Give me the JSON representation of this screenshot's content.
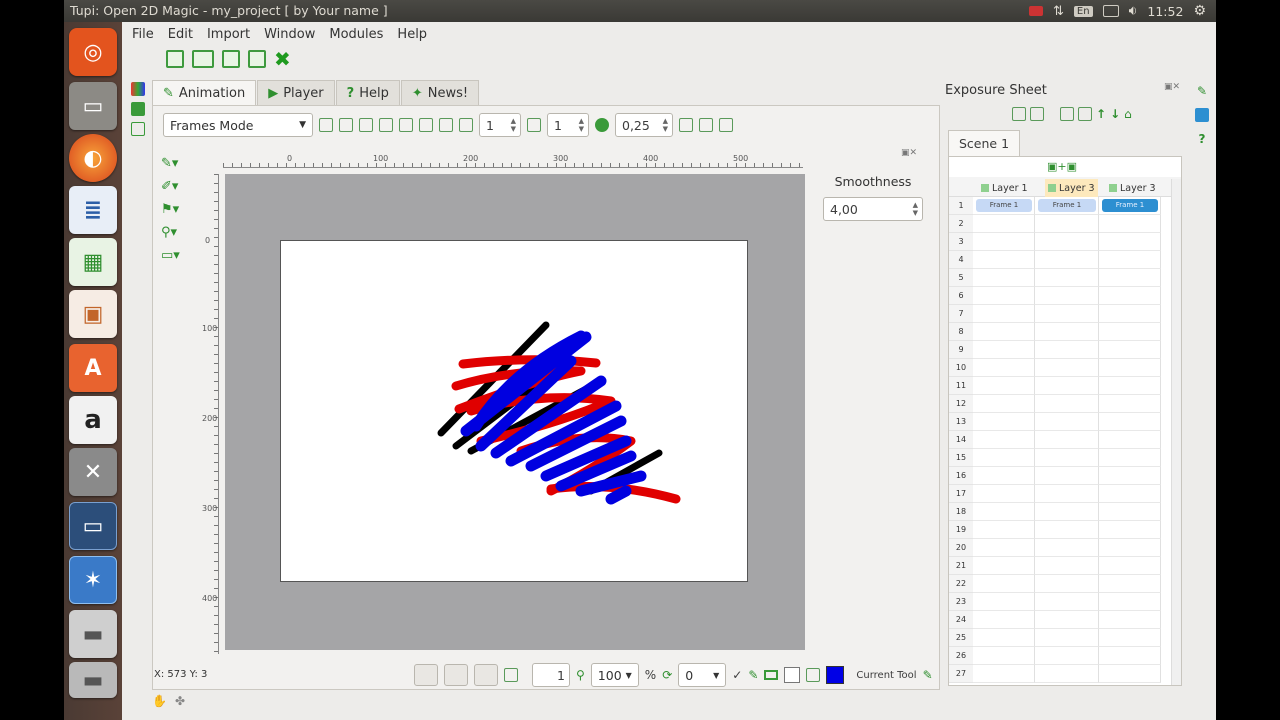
{
  "window": {
    "title": "Tupi: Open 2D Magic - my_project [ by Your name ]"
  },
  "system_tray": {
    "keyboard": "En",
    "clock": "11:52"
  },
  "menu": [
    "File",
    "Edit",
    "Import",
    "Window",
    "Modules",
    "Help"
  ],
  "tabs": [
    {
      "label": "Animation",
      "icon": "animation-icon"
    },
    {
      "label": "Player",
      "icon": "play-icon"
    },
    {
      "label": "Help",
      "icon": "question-icon"
    },
    {
      "label": "News!",
      "icon": "bird-icon"
    }
  ],
  "animation_toolbar": {
    "mode": "Frames Mode",
    "spin1": "1",
    "spin2": "1",
    "opacity": "0,25"
  },
  "rulers": {
    "h_labels": [
      "0",
      "100",
      "200",
      "300",
      "400",
      "500"
    ],
    "v_labels": [
      "0",
      "100",
      "200",
      "300",
      "400"
    ]
  },
  "smoothness": {
    "label": "Smoothness",
    "value": "4,00"
  },
  "status": {
    "coords": "X: 573 Y: 3",
    "frame": "1",
    "zoom": "100",
    "zoom_unit": "%",
    "rotation": "0",
    "current_tool_label": "Current Tool",
    "current_color": "#0000e6"
  },
  "exposure": {
    "title": "Exposure Sheet",
    "scene_tab": "Scene 1",
    "layers": [
      "Layer 1",
      "Layer 3",
      "Layer 3"
    ],
    "frame_labels": [
      "Frame 1",
      "Frame 1",
      "Frame 1"
    ],
    "rows": [
      "1",
      "2",
      "3",
      "4",
      "5",
      "6",
      "7",
      "8",
      "9",
      "10",
      "11",
      "12",
      "13",
      "14",
      "15",
      "16",
      "17",
      "18",
      "19",
      "20",
      "21",
      "22",
      "23",
      "24",
      "25",
      "26",
      "27"
    ]
  },
  "strokes": {
    "black": "#000000",
    "red": "#e00000",
    "blue": "#0000e0"
  }
}
